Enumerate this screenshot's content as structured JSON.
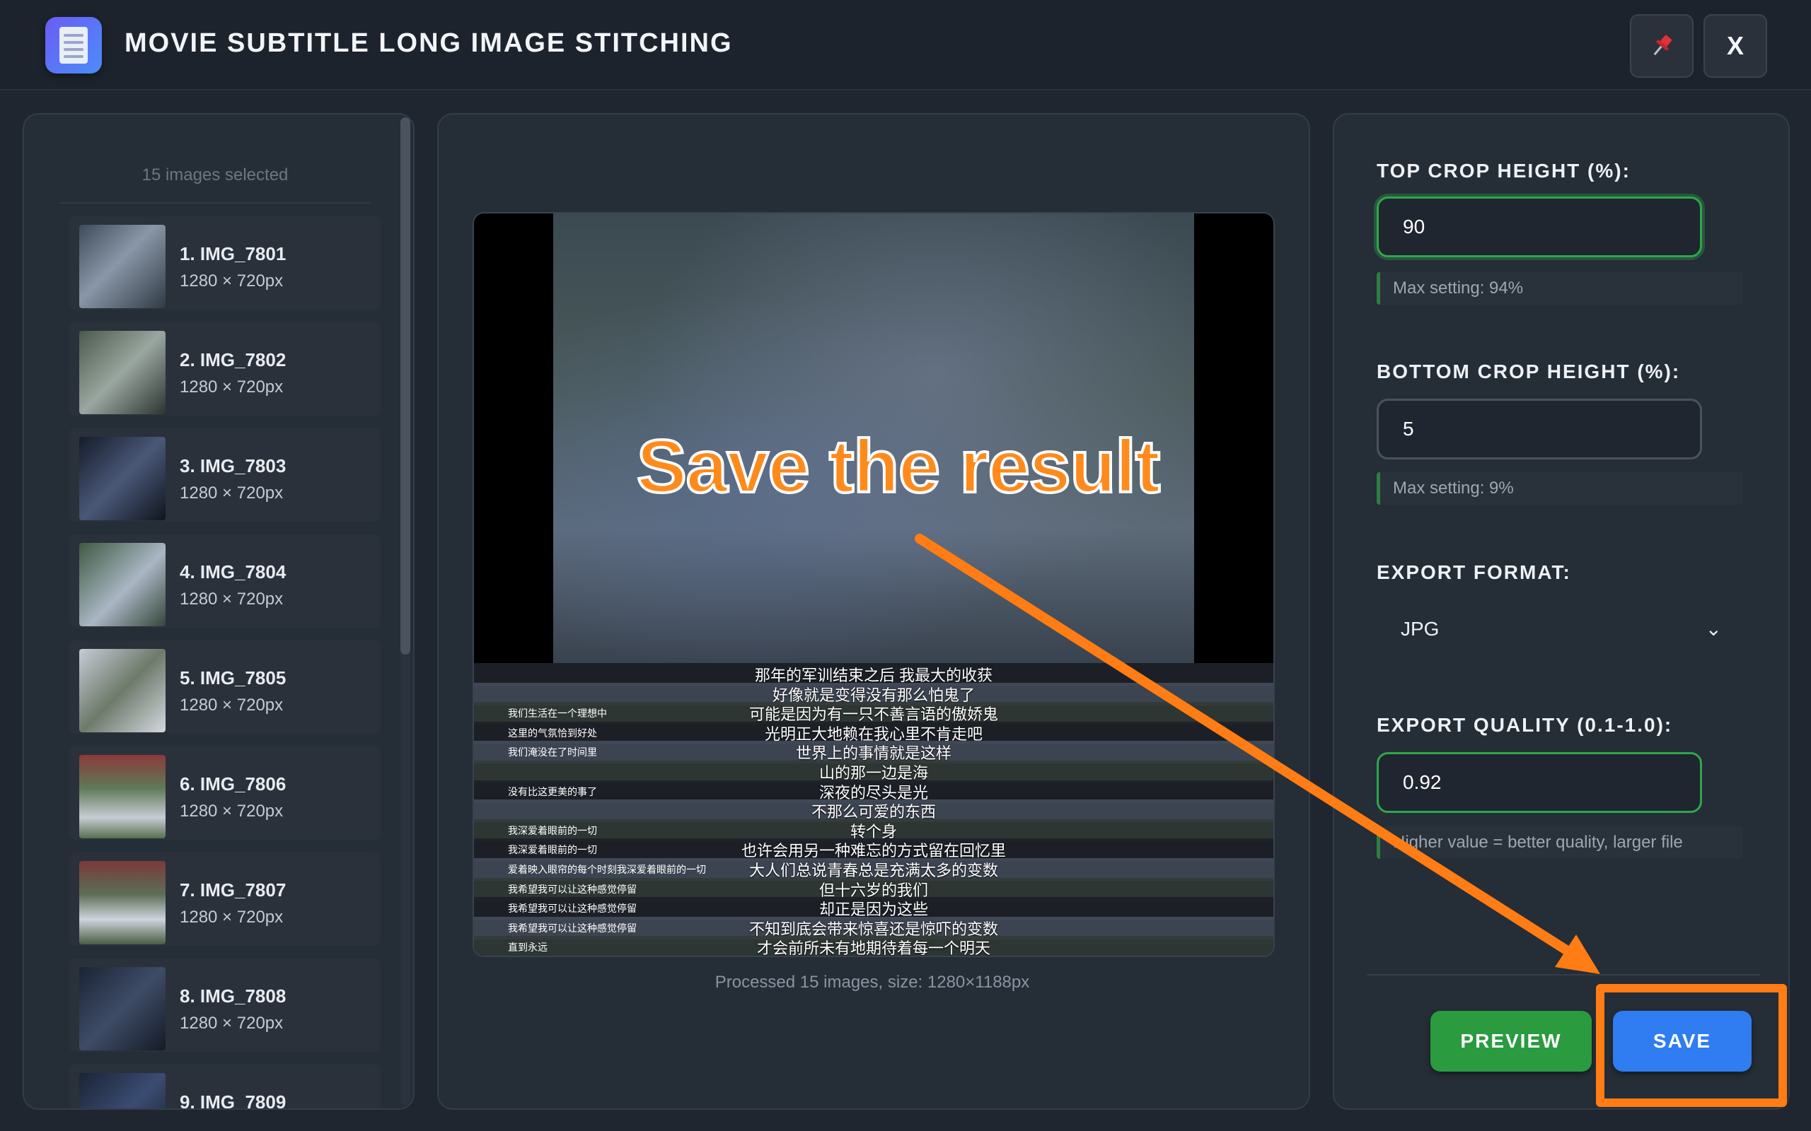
{
  "window": {
    "title": "MOVIE SUBTITLE LONG IMAGE STITCHING",
    "pin_icon": "pin-icon",
    "close_label": "X"
  },
  "left_panel": {
    "selected_count": "15 images selected",
    "items": [
      {
        "name": "1. IMG_7801",
        "size": "1280 × 720px"
      },
      {
        "name": "2. IMG_7802",
        "size": "1280 × 720px"
      },
      {
        "name": "3. IMG_7803",
        "size": "1280 × 720px"
      },
      {
        "name": "4. IMG_7804",
        "size": "1280 × 720px"
      },
      {
        "name": "5. IMG_7805",
        "size": "1280 × 720px"
      },
      {
        "name": "6. IMG_7806",
        "size": "1280 × 720px"
      },
      {
        "name": "7. IMG_7807",
        "size": "1280 × 720px"
      },
      {
        "name": "8. IMG_7808",
        "size": "1280 × 720px"
      },
      {
        "name": "9. IMG_7809",
        "size": ""
      }
    ]
  },
  "preview": {
    "overlay_text": "Save the result",
    "subtitles": [
      {
        "side": "",
        "text": "那年的军训结束之后 我最大的收获"
      },
      {
        "side": "",
        "text": "好像就是变得没有那么怕鬼了"
      },
      {
        "side": "我们生活在一个理想中",
        "text": "可能是因为有一只不善言语的傲娇鬼"
      },
      {
        "side": "这里的气氛恰到好处",
        "text": "光明正大地赖在我心里不肯走吧"
      },
      {
        "side": "我们淹没在了时间里",
        "text": "世界上的事情就是这样"
      },
      {
        "side": "",
        "text": "山的那一边是海"
      },
      {
        "side": "没有比这更美的事了",
        "text": "深夜的尽头是光"
      },
      {
        "side": "",
        "text": "不那么可爱的东西"
      },
      {
        "side": "我深爱着眼前的一切",
        "text": "转个身"
      },
      {
        "side": "我深爱着眼前的一切",
        "text": "也许会用另一种难忘的方式留在回忆里"
      },
      {
        "side": "爱着映入眼帘的每个时刻我深爱着眼前的一切",
        "text": "大人们总说青春总是充满太多的变数"
      },
      {
        "side": "我希望我可以让这种感觉停留",
        "text": "但十六岁的我们"
      },
      {
        "side": "我希望我可以让这种感觉停留",
        "text": "却正是因为这些"
      },
      {
        "side": "我希望我可以让这种感觉停留",
        "text": "不知到底会带来惊喜还是惊吓的变数"
      },
      {
        "side": "直到永远",
        "text": "才会前所未有地期待着每一个明天"
      }
    ],
    "processed_text": "Processed 15 images, size: 1280×1188px"
  },
  "settings": {
    "top_crop": {
      "label": "TOP CROP HEIGHT (%):",
      "value": "90",
      "hint": "Max setting: 94%"
    },
    "bottom_crop": {
      "label": "BOTTOM CROP HEIGHT (%):",
      "value": "5",
      "hint": "Max setting: 9%"
    },
    "export_format": {
      "label": "EXPORT FORMAT:",
      "value": "JPG"
    },
    "export_quality": {
      "label": "EXPORT QUALITY (0.1-1.0):",
      "value": "0.92",
      "hint": "Higher value = better quality, larger file"
    }
  },
  "buttons": {
    "preview": "PREVIEW",
    "save": "SAVE"
  },
  "colors": {
    "accent_green": "#2a9b3f",
    "accent_blue": "#2f7df0",
    "annotation_orange": "#ff7d14"
  }
}
